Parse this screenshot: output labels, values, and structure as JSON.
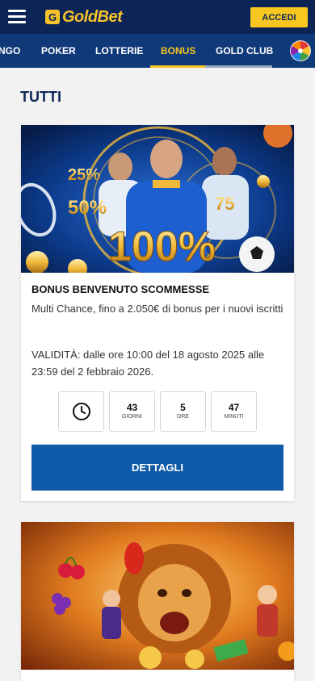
{
  "header": {
    "logo_text": "GoldBet",
    "logo_mark": "G",
    "login_label": "ACCEDI"
  },
  "nav": {
    "items": [
      "NGO",
      "POKER",
      "LOTTERIE",
      "BONUS",
      "GOLD CLUB"
    ],
    "active": "BONUS"
  },
  "section_title": "TUTTI",
  "promo": {
    "title": "BONUS BENVENUTO SCOMMESSE",
    "description": "Multi Chance, fino a 2.050€ di bonus per i nuovi iscritti",
    "validity": "VALIDITÀ: dalle ore 10:00 del 18 agosto 2025 alle 23:59 del 2 febbraio 2026.",
    "countdown": [
      {
        "value": "43",
        "label": "GIORNI"
      },
      {
        "value": "5",
        "label": "ORE"
      },
      {
        "value": "47",
        "label": "MINUTI"
      }
    ],
    "button_label": "DETTAGLI",
    "banner_badges": [
      "25%",
      "50%",
      "75",
      "100%"
    ]
  },
  "colors": {
    "topbar": "#0d2457",
    "navbar": "#10397a",
    "accent_yellow": "#f7c71f",
    "button_blue": "#0f5aa8"
  }
}
